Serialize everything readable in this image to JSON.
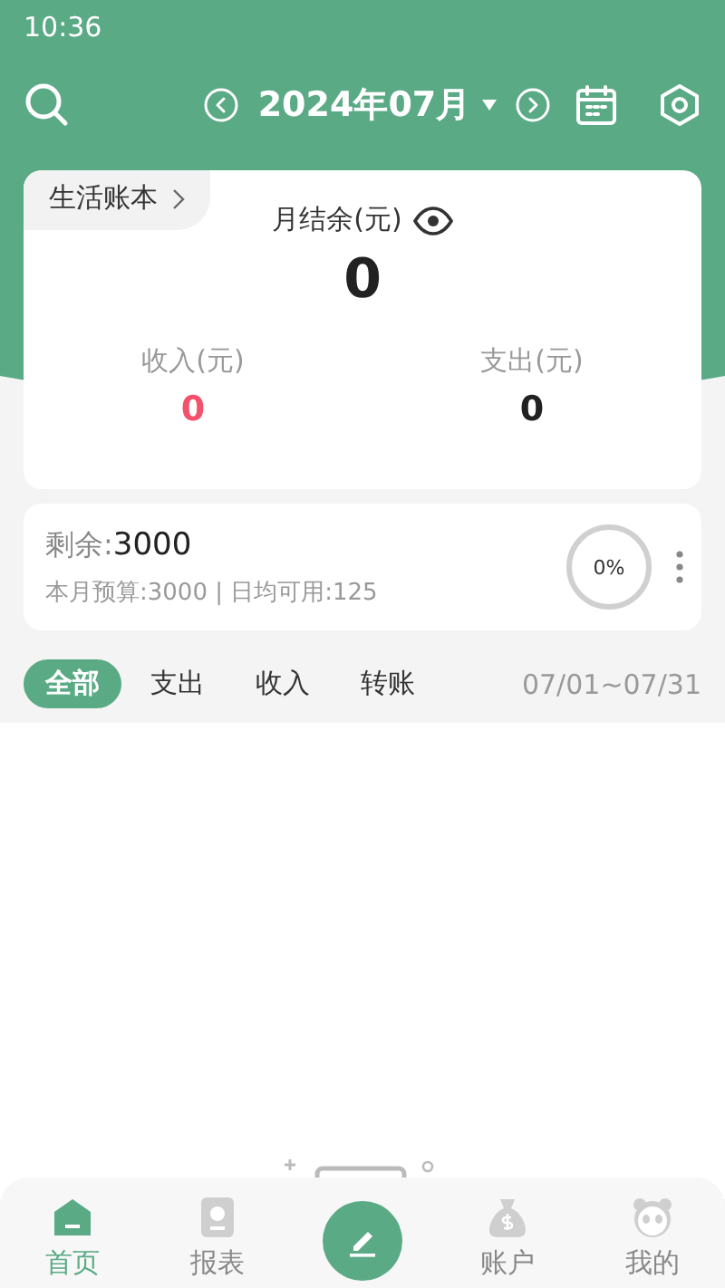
{
  "status_bar": {
    "time": "10:36"
  },
  "header": {
    "month": "2024年07月"
  },
  "summary": {
    "book": "生活账本",
    "balance_label": "月结余(元)",
    "balance": "0",
    "income_label": "收入(元)",
    "income": "0",
    "expense_label": "支出(元)",
    "expense": "0"
  },
  "budget": {
    "remaining_label": "剩余:",
    "remaining": "3000",
    "detail": "本月预算:3000 | 日均可用:125",
    "percent": "0%"
  },
  "filters": [
    {
      "label": "全部",
      "selected": true
    },
    {
      "label": "支出",
      "selected": false
    },
    {
      "label": "收入",
      "selected": false
    },
    {
      "label": "转账",
      "selected": false
    }
  ],
  "date_range": "07/01~07/31",
  "nav": [
    {
      "label": "首页",
      "kind": "home",
      "selected": true
    },
    {
      "label": "报表",
      "kind": "report",
      "selected": false
    },
    {
      "kind": "add",
      "selected": false
    },
    {
      "label": "账户",
      "kind": "account",
      "selected": false
    },
    {
      "label": "我的",
      "kind": "profile",
      "selected": false
    }
  ]
}
